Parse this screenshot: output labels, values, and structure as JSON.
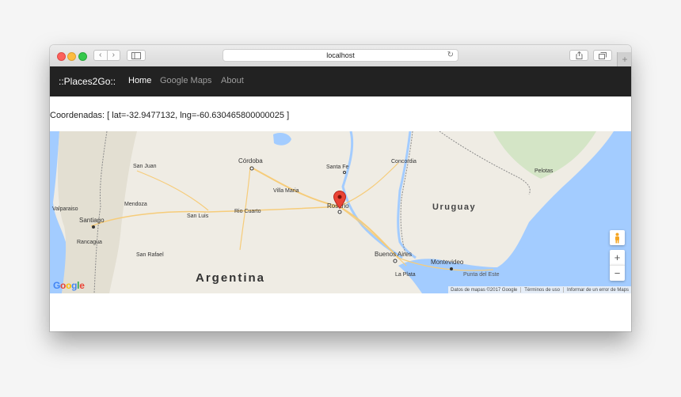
{
  "browser": {
    "address": "localhost",
    "nav_back": "‹",
    "nav_forward": "›",
    "reload_glyph": "↻",
    "new_tab_glyph": "+"
  },
  "navbar": {
    "brand": "::Places2Go::",
    "links": [
      {
        "label": "Home",
        "active": true
      },
      {
        "label": "Google Maps",
        "active": false
      },
      {
        "label": "About",
        "active": false
      }
    ]
  },
  "coords_text": "Coordenadas: [ lat=-32.9477132, lng=-60.630465800000025 ]",
  "map": {
    "cities": {
      "cordoba": "Córdoba",
      "santa_fe": "Santa Fe",
      "concordia": "Concordia",
      "pelotas": "Pelotas",
      "san_juan": "San Juan",
      "villa_maria": "Villa Maria",
      "rosario": "Rosario",
      "valparaiso": "Valparaiso",
      "mendoza": "Mendoza",
      "san_luis": "San Luis",
      "rio_cuarto": "Rio Cuarto",
      "santiago": "Santiago",
      "rancagua": "Rancagua",
      "san_rafael": "San Rafael",
      "buenos_aires": "Buenos Aires",
      "montevideo": "Montevideo",
      "la_plata": "La Plata",
      "punta_del_este": "Punta del Este"
    },
    "countries": {
      "uruguay": "Uruguay",
      "argentina": "Argentina"
    },
    "zoom_in": "+",
    "zoom_out": "−",
    "logo": [
      "G",
      "o",
      "o",
      "g",
      "l",
      "e"
    ],
    "logo_colors": [
      "#4285f4",
      "#ea4335",
      "#fbbc05",
      "#4285f4",
      "#34a853",
      "#ea4335"
    ],
    "attribution": {
      "data": "Datos de mapas ©2017 Google",
      "terms": "Términos de uso",
      "report": "Informar de un error de Maps"
    },
    "marker_color": "#ea4335",
    "water_color": "#a3ccff"
  }
}
